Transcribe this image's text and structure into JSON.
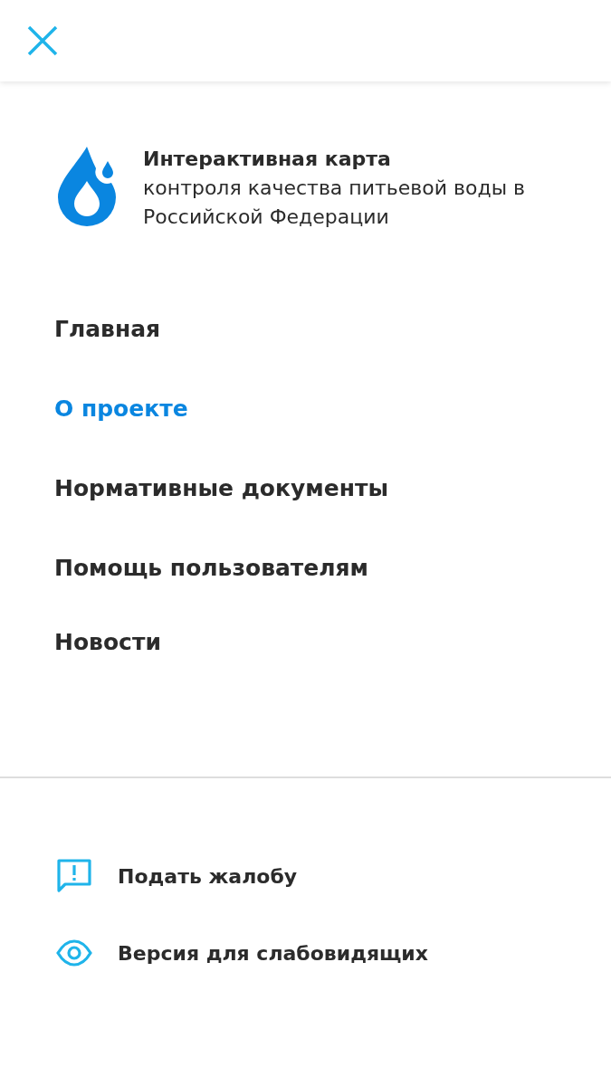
{
  "brand": {
    "title": "Интерактивная карта",
    "subtitle": "контроля качества питьевой воды в Российской Федерации"
  },
  "menu": [
    {
      "label": "Главная",
      "selected": false
    },
    {
      "label": "О проекте",
      "selected": true
    },
    {
      "label": "Нормативные документы",
      "selected": false
    },
    {
      "label": "Помощь пользователям",
      "selected": false
    },
    {
      "label": "Новости",
      "selected": false
    }
  ],
  "links": [
    {
      "kind": "complaint",
      "label": "Подать жалобу"
    },
    {
      "kind": "accessibility",
      "label": "Версия для слабовидящих"
    }
  ]
}
